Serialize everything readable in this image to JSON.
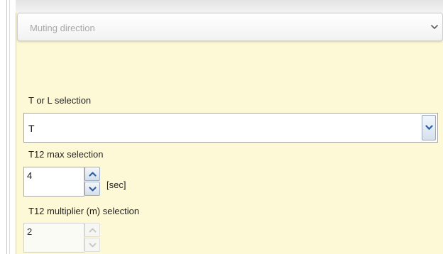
{
  "muting_direction": {
    "label": "Muting direction",
    "expand_icon": "chevron-down-icon"
  },
  "tl_selection": {
    "label": "T or L selection",
    "value": "T",
    "dropdown_icon": "chevron-down-icon"
  },
  "t12_max": {
    "label": "T12 max selection",
    "value": "4",
    "unit": "[sec]",
    "up_icon": "chevron-up-icon",
    "down_icon": "chevron-down-icon"
  },
  "t12_multiplier": {
    "label": "T12 multiplier (m) selection",
    "value": "2",
    "disabled": true,
    "up_icon": "chevron-up-icon",
    "down_icon": "chevron-down-icon"
  },
  "colors": {
    "panel_background": "#fdf9d7",
    "spinner_arrow": "#2f5f9e",
    "disabled_arrow": "#c9c9c9"
  }
}
